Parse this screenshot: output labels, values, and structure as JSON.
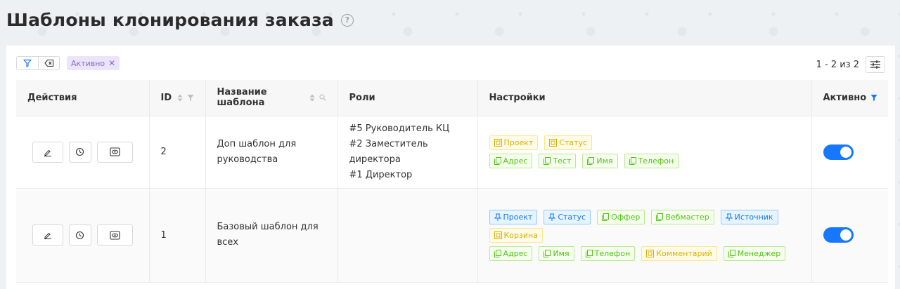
{
  "header": {
    "title": "Шаблоны клонирования заказа",
    "help_glyph": "?"
  },
  "filters": {
    "active_chip": "Активно"
  },
  "pagination": {
    "text": "1 - 2 из 2"
  },
  "table": {
    "columns": {
      "actions": "Действия",
      "id": "ID",
      "name": "Название шаблона",
      "roles": "Роли",
      "settings": "Настройки",
      "active": "Активно"
    },
    "rows": [
      {
        "id": "2",
        "name": "Доп шаблон для руководства",
        "roles": [
          "#5 Руководитель КЦ",
          "#2 Заместитель директора",
          "#1 Директор"
        ],
        "tag_lines": [
          [
            {
              "label": "Проект",
              "color": "yellow"
            },
            {
              "label": "Статус",
              "color": "yellow"
            }
          ],
          [
            {
              "label": "Адрес",
              "color": "green"
            },
            {
              "label": "Тест",
              "color": "green"
            },
            {
              "label": "Имя",
              "color": "green"
            },
            {
              "label": "Телефон",
              "color": "green"
            }
          ]
        ],
        "active": true
      },
      {
        "id": "1",
        "name": "Базовый шаблон для всех",
        "roles": [],
        "tag_lines": [
          [
            {
              "label": "Проект",
              "color": "blue"
            },
            {
              "label": "Статус",
              "color": "blue"
            },
            {
              "label": "Оффер",
              "color": "green"
            },
            {
              "label": "Вебмастер",
              "color": "green"
            },
            {
              "label": "Источник",
              "color": "blue"
            }
          ],
          [
            {
              "label": "Корзина",
              "color": "yellow"
            }
          ],
          [
            {
              "label": "Адрес",
              "color": "green"
            },
            {
              "label": "Имя",
              "color": "green"
            },
            {
              "label": "Телефон",
              "color": "green"
            },
            {
              "label": "Комментарий",
              "color": "yellow"
            },
            {
              "label": "Менеджер",
              "color": "green"
            }
          ]
        ],
        "active": true
      }
    ]
  },
  "colors": {
    "accent": "#1677ff",
    "chip_bg": "#ece4fa",
    "chip_text": "#8a6bc2"
  }
}
